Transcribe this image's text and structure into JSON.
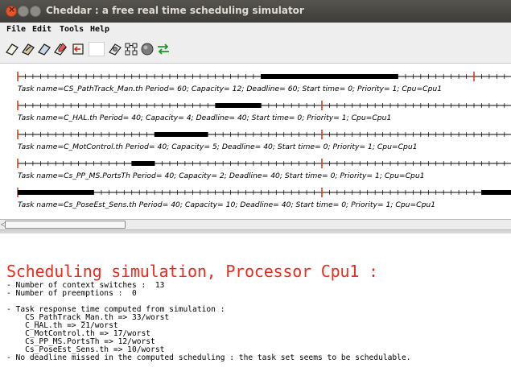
{
  "window": {
    "title": "Cheddar : a free real time scheduling simulator"
  },
  "menu": {
    "items": [
      "File",
      "Edit",
      "Tools",
      "Help"
    ]
  },
  "toolbar": {
    "icons": [
      "open-icon",
      "edit-icon",
      "save-icon",
      "edit-system-icon",
      "back-icon",
      "blank-field",
      "settings-icon",
      "network-icon",
      "scheduling-icon",
      "run-icon"
    ]
  },
  "tasks": [
    {
      "label": "Task name=CS_PathTrack_Man.th     Period= 60; Capacity= 12; Deadline= 60; Start time= 0; Priority= 1; Cpu=Cpu1",
      "period": 60,
      "capacity": 12,
      "deadline": 60,
      "start_time": 0
    },
    {
      "label": "Task name=C_HAL.th     Period= 40; Capacity= 4; Deadline= 40; Start time= 0; Priority= 1; Cpu=Cpu1",
      "period": 40,
      "capacity": 4,
      "deadline": 40,
      "start_time": 0
    },
    {
      "label": "Task name=C_MotControl.th     Period= 40; Capacity= 5; Deadline= 40; Start time= 0; Priority= 1; Cpu=Cpu1",
      "period": 40,
      "capacity": 5,
      "deadline": 40,
      "start_time": 0
    },
    {
      "label": "Task name=Cs_PP_MS.PortsTh     Period= 40; Capacity= 2; Deadline= 40; Start time= 0; Priority= 1; Cpu=Cpu1",
      "period": 40,
      "capacity": 2,
      "deadline": 40,
      "start_time": 0
    },
    {
      "label": "Task name=Cs_PoseEst_Sens.th     Period= 40; Capacity= 10; Deadline= 40; Start time= 0; Priority= 1; Cpu=Cpu1",
      "period": 40,
      "capacity": 10,
      "deadline": 40,
      "start_time": 0
    }
  ],
  "output": {
    "title": "Scheduling simulation, Processor Cpu1 :",
    "lines": [
      "- Number of context switches :  13",
      "- Number of preemptions :  0",
      "",
      "- Task response time computed from simulation :",
      "    CS_PathTrack_Man.th => 33/worst",
      "    C_HAL.th => 21/worst",
      "    C_MotControl.th => 17/worst",
      "    Cs_PP_MS.PortsTh => 12/worst",
      "    Cs_PoseEst_Sens.th => 10/worst",
      "- No deadline missed in the computed scheduling : the task set seems to be schedulable."
    ]
  },
  "colors": {
    "title_red": "#ee2a1c",
    "release_marker": "#e23a1a",
    "bar": "#000000"
  }
}
